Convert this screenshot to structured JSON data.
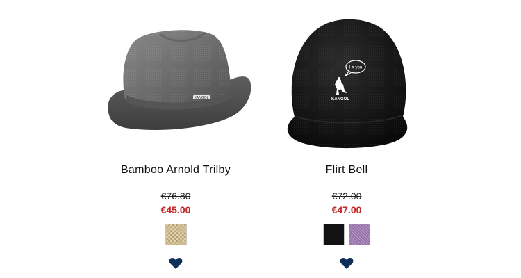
{
  "products": [
    {
      "name": "Bamboo Arnold Trilby",
      "old_price": "€76.80",
      "sale_price": "€45.00",
      "image_icon": "trilby-hat-icon",
      "brand_mark": "KANGOL",
      "swatches": [
        {
          "color_name": "bamboo",
          "color": "#d9c28e"
        }
      ]
    },
    {
      "name": "Flirt Bell",
      "old_price": "€72.00",
      "sale_price": "€47.00",
      "image_icon": "bucket-hat-icon",
      "brand_mark": "KANGOL",
      "speech_bubble": "I ♥ you",
      "swatches": [
        {
          "color_name": "black",
          "color": "#121212"
        },
        {
          "color_name": "purple",
          "color": "#a27ab5"
        }
      ]
    }
  ],
  "colors": {
    "sale_price": "#c62828",
    "wishlist_heart": "#0e2f5a"
  },
  "wishlist_icon": "heart-icon"
}
